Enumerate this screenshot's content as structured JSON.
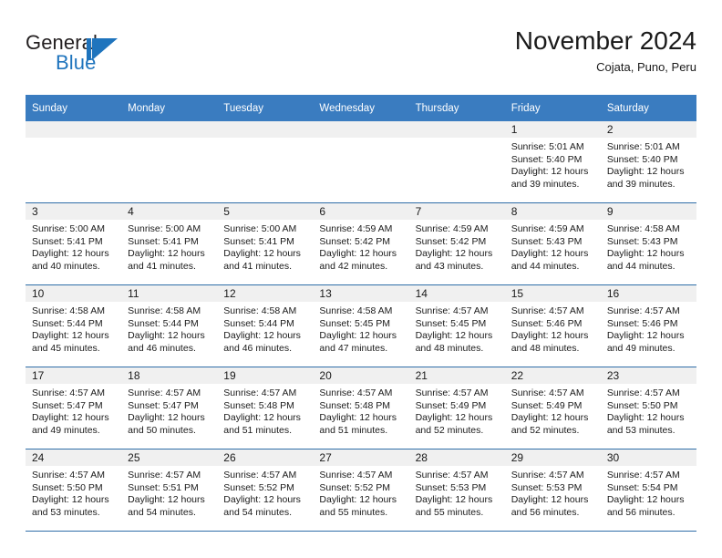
{
  "brand": {
    "name_part1": "General",
    "name_part2": "Blue",
    "logo_icon": "blue-triangle-logo",
    "accent_color": "#1f74bd"
  },
  "header": {
    "title": "November 2024",
    "subtitle": "Cojata, Puno, Peru"
  },
  "theme": {
    "header_row_bg": "#3a7cc0",
    "row_divider": "#2f6ea8",
    "daynum_band_bg": "#f0f0f0",
    "text": "#1a1a1a"
  },
  "weekdays": [
    "Sunday",
    "Monday",
    "Tuesday",
    "Wednesday",
    "Thursday",
    "Friday",
    "Saturday"
  ],
  "weeks": [
    [
      {
        "day": "",
        "sunrise": "",
        "sunset": "",
        "daylight": ""
      },
      {
        "day": "",
        "sunrise": "",
        "sunset": "",
        "daylight": ""
      },
      {
        "day": "",
        "sunrise": "",
        "sunset": "",
        "daylight": ""
      },
      {
        "day": "",
        "sunrise": "",
        "sunset": "",
        "daylight": ""
      },
      {
        "day": "",
        "sunrise": "",
        "sunset": "",
        "daylight": ""
      },
      {
        "day": "1",
        "sunrise": "Sunrise: 5:01 AM",
        "sunset": "Sunset: 5:40 PM",
        "daylight": "Daylight: 12 hours and 39 minutes."
      },
      {
        "day": "2",
        "sunrise": "Sunrise: 5:01 AM",
        "sunset": "Sunset: 5:40 PM",
        "daylight": "Daylight: 12 hours and 39 minutes."
      }
    ],
    [
      {
        "day": "3",
        "sunrise": "Sunrise: 5:00 AM",
        "sunset": "Sunset: 5:41 PM",
        "daylight": "Daylight: 12 hours and 40 minutes."
      },
      {
        "day": "4",
        "sunrise": "Sunrise: 5:00 AM",
        "sunset": "Sunset: 5:41 PM",
        "daylight": "Daylight: 12 hours and 41 minutes."
      },
      {
        "day": "5",
        "sunrise": "Sunrise: 5:00 AM",
        "sunset": "Sunset: 5:41 PM",
        "daylight": "Daylight: 12 hours and 41 minutes."
      },
      {
        "day": "6",
        "sunrise": "Sunrise: 4:59 AM",
        "sunset": "Sunset: 5:42 PM",
        "daylight": "Daylight: 12 hours and 42 minutes."
      },
      {
        "day": "7",
        "sunrise": "Sunrise: 4:59 AM",
        "sunset": "Sunset: 5:42 PM",
        "daylight": "Daylight: 12 hours and 43 minutes."
      },
      {
        "day": "8",
        "sunrise": "Sunrise: 4:59 AM",
        "sunset": "Sunset: 5:43 PM",
        "daylight": "Daylight: 12 hours and 44 minutes."
      },
      {
        "day": "9",
        "sunrise": "Sunrise: 4:58 AM",
        "sunset": "Sunset: 5:43 PM",
        "daylight": "Daylight: 12 hours and 44 minutes."
      }
    ],
    [
      {
        "day": "10",
        "sunrise": "Sunrise: 4:58 AM",
        "sunset": "Sunset: 5:44 PM",
        "daylight": "Daylight: 12 hours and 45 minutes."
      },
      {
        "day": "11",
        "sunrise": "Sunrise: 4:58 AM",
        "sunset": "Sunset: 5:44 PM",
        "daylight": "Daylight: 12 hours and 46 minutes."
      },
      {
        "day": "12",
        "sunrise": "Sunrise: 4:58 AM",
        "sunset": "Sunset: 5:44 PM",
        "daylight": "Daylight: 12 hours and 46 minutes."
      },
      {
        "day": "13",
        "sunrise": "Sunrise: 4:58 AM",
        "sunset": "Sunset: 5:45 PM",
        "daylight": "Daylight: 12 hours and 47 minutes."
      },
      {
        "day": "14",
        "sunrise": "Sunrise: 4:57 AM",
        "sunset": "Sunset: 5:45 PM",
        "daylight": "Daylight: 12 hours and 48 minutes."
      },
      {
        "day": "15",
        "sunrise": "Sunrise: 4:57 AM",
        "sunset": "Sunset: 5:46 PM",
        "daylight": "Daylight: 12 hours and 48 minutes."
      },
      {
        "day": "16",
        "sunrise": "Sunrise: 4:57 AM",
        "sunset": "Sunset: 5:46 PM",
        "daylight": "Daylight: 12 hours and 49 minutes."
      }
    ],
    [
      {
        "day": "17",
        "sunrise": "Sunrise: 4:57 AM",
        "sunset": "Sunset: 5:47 PM",
        "daylight": "Daylight: 12 hours and 49 minutes."
      },
      {
        "day": "18",
        "sunrise": "Sunrise: 4:57 AM",
        "sunset": "Sunset: 5:47 PM",
        "daylight": "Daylight: 12 hours and 50 minutes."
      },
      {
        "day": "19",
        "sunrise": "Sunrise: 4:57 AM",
        "sunset": "Sunset: 5:48 PM",
        "daylight": "Daylight: 12 hours and 51 minutes."
      },
      {
        "day": "20",
        "sunrise": "Sunrise: 4:57 AM",
        "sunset": "Sunset: 5:48 PM",
        "daylight": "Daylight: 12 hours and 51 minutes."
      },
      {
        "day": "21",
        "sunrise": "Sunrise: 4:57 AM",
        "sunset": "Sunset: 5:49 PM",
        "daylight": "Daylight: 12 hours and 52 minutes."
      },
      {
        "day": "22",
        "sunrise": "Sunrise: 4:57 AM",
        "sunset": "Sunset: 5:49 PM",
        "daylight": "Daylight: 12 hours and 52 minutes."
      },
      {
        "day": "23",
        "sunrise": "Sunrise: 4:57 AM",
        "sunset": "Sunset: 5:50 PM",
        "daylight": "Daylight: 12 hours and 53 minutes."
      }
    ],
    [
      {
        "day": "24",
        "sunrise": "Sunrise: 4:57 AM",
        "sunset": "Sunset: 5:50 PM",
        "daylight": "Daylight: 12 hours and 53 minutes."
      },
      {
        "day": "25",
        "sunrise": "Sunrise: 4:57 AM",
        "sunset": "Sunset: 5:51 PM",
        "daylight": "Daylight: 12 hours and 54 minutes."
      },
      {
        "day": "26",
        "sunrise": "Sunrise: 4:57 AM",
        "sunset": "Sunset: 5:52 PM",
        "daylight": "Daylight: 12 hours and 54 minutes."
      },
      {
        "day": "27",
        "sunrise": "Sunrise: 4:57 AM",
        "sunset": "Sunset: 5:52 PM",
        "daylight": "Daylight: 12 hours and 55 minutes."
      },
      {
        "day": "28",
        "sunrise": "Sunrise: 4:57 AM",
        "sunset": "Sunset: 5:53 PM",
        "daylight": "Daylight: 12 hours and 55 minutes."
      },
      {
        "day": "29",
        "sunrise": "Sunrise: 4:57 AM",
        "sunset": "Sunset: 5:53 PM",
        "daylight": "Daylight: 12 hours and 56 minutes."
      },
      {
        "day": "30",
        "sunrise": "Sunrise: 4:57 AM",
        "sunset": "Sunset: 5:54 PM",
        "daylight": "Daylight: 12 hours and 56 minutes."
      }
    ]
  ]
}
